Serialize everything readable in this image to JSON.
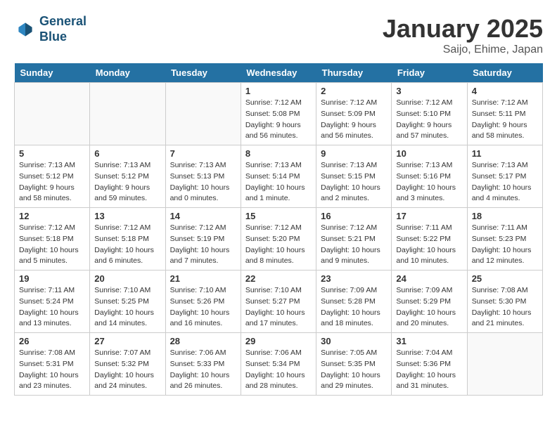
{
  "header": {
    "logo_line1": "General",
    "logo_line2": "Blue",
    "title": "January 2025",
    "subtitle": "Saijo, Ehime, Japan"
  },
  "weekdays": [
    "Sunday",
    "Monday",
    "Tuesday",
    "Wednesday",
    "Thursday",
    "Friday",
    "Saturday"
  ],
  "weeks": [
    [
      {
        "day": "",
        "info": ""
      },
      {
        "day": "",
        "info": ""
      },
      {
        "day": "",
        "info": ""
      },
      {
        "day": "1",
        "info": "Sunrise: 7:12 AM\nSunset: 5:08 PM\nDaylight: 9 hours\nand 56 minutes."
      },
      {
        "day": "2",
        "info": "Sunrise: 7:12 AM\nSunset: 5:09 PM\nDaylight: 9 hours\nand 56 minutes."
      },
      {
        "day": "3",
        "info": "Sunrise: 7:12 AM\nSunset: 5:10 PM\nDaylight: 9 hours\nand 57 minutes."
      },
      {
        "day": "4",
        "info": "Sunrise: 7:12 AM\nSunset: 5:11 PM\nDaylight: 9 hours\nand 58 minutes."
      }
    ],
    [
      {
        "day": "5",
        "info": "Sunrise: 7:13 AM\nSunset: 5:12 PM\nDaylight: 9 hours\nand 58 minutes."
      },
      {
        "day": "6",
        "info": "Sunrise: 7:13 AM\nSunset: 5:12 PM\nDaylight: 9 hours\nand 59 minutes."
      },
      {
        "day": "7",
        "info": "Sunrise: 7:13 AM\nSunset: 5:13 PM\nDaylight: 10 hours\nand 0 minutes."
      },
      {
        "day": "8",
        "info": "Sunrise: 7:13 AM\nSunset: 5:14 PM\nDaylight: 10 hours\nand 1 minute."
      },
      {
        "day": "9",
        "info": "Sunrise: 7:13 AM\nSunset: 5:15 PM\nDaylight: 10 hours\nand 2 minutes."
      },
      {
        "day": "10",
        "info": "Sunrise: 7:13 AM\nSunset: 5:16 PM\nDaylight: 10 hours\nand 3 minutes."
      },
      {
        "day": "11",
        "info": "Sunrise: 7:13 AM\nSunset: 5:17 PM\nDaylight: 10 hours\nand 4 minutes."
      }
    ],
    [
      {
        "day": "12",
        "info": "Sunrise: 7:12 AM\nSunset: 5:18 PM\nDaylight: 10 hours\nand 5 minutes."
      },
      {
        "day": "13",
        "info": "Sunrise: 7:12 AM\nSunset: 5:18 PM\nDaylight: 10 hours\nand 6 minutes."
      },
      {
        "day": "14",
        "info": "Sunrise: 7:12 AM\nSunset: 5:19 PM\nDaylight: 10 hours\nand 7 minutes."
      },
      {
        "day": "15",
        "info": "Sunrise: 7:12 AM\nSunset: 5:20 PM\nDaylight: 10 hours\nand 8 minutes."
      },
      {
        "day": "16",
        "info": "Sunrise: 7:12 AM\nSunset: 5:21 PM\nDaylight: 10 hours\nand 9 minutes."
      },
      {
        "day": "17",
        "info": "Sunrise: 7:11 AM\nSunset: 5:22 PM\nDaylight: 10 hours\nand 10 minutes."
      },
      {
        "day": "18",
        "info": "Sunrise: 7:11 AM\nSunset: 5:23 PM\nDaylight: 10 hours\nand 12 minutes."
      }
    ],
    [
      {
        "day": "19",
        "info": "Sunrise: 7:11 AM\nSunset: 5:24 PM\nDaylight: 10 hours\nand 13 minutes."
      },
      {
        "day": "20",
        "info": "Sunrise: 7:10 AM\nSunset: 5:25 PM\nDaylight: 10 hours\nand 14 minutes."
      },
      {
        "day": "21",
        "info": "Sunrise: 7:10 AM\nSunset: 5:26 PM\nDaylight: 10 hours\nand 16 minutes."
      },
      {
        "day": "22",
        "info": "Sunrise: 7:10 AM\nSunset: 5:27 PM\nDaylight: 10 hours\nand 17 minutes."
      },
      {
        "day": "23",
        "info": "Sunrise: 7:09 AM\nSunset: 5:28 PM\nDaylight: 10 hours\nand 18 minutes."
      },
      {
        "day": "24",
        "info": "Sunrise: 7:09 AM\nSunset: 5:29 PM\nDaylight: 10 hours\nand 20 minutes."
      },
      {
        "day": "25",
        "info": "Sunrise: 7:08 AM\nSunset: 5:30 PM\nDaylight: 10 hours\nand 21 minutes."
      }
    ],
    [
      {
        "day": "26",
        "info": "Sunrise: 7:08 AM\nSunset: 5:31 PM\nDaylight: 10 hours\nand 23 minutes."
      },
      {
        "day": "27",
        "info": "Sunrise: 7:07 AM\nSunset: 5:32 PM\nDaylight: 10 hours\nand 24 minutes."
      },
      {
        "day": "28",
        "info": "Sunrise: 7:06 AM\nSunset: 5:33 PM\nDaylight: 10 hours\nand 26 minutes."
      },
      {
        "day": "29",
        "info": "Sunrise: 7:06 AM\nSunset: 5:34 PM\nDaylight: 10 hours\nand 28 minutes."
      },
      {
        "day": "30",
        "info": "Sunrise: 7:05 AM\nSunset: 5:35 PM\nDaylight: 10 hours\nand 29 minutes."
      },
      {
        "day": "31",
        "info": "Sunrise: 7:04 AM\nSunset: 5:36 PM\nDaylight: 10 hours\nand 31 minutes."
      },
      {
        "day": "",
        "info": ""
      }
    ]
  ]
}
